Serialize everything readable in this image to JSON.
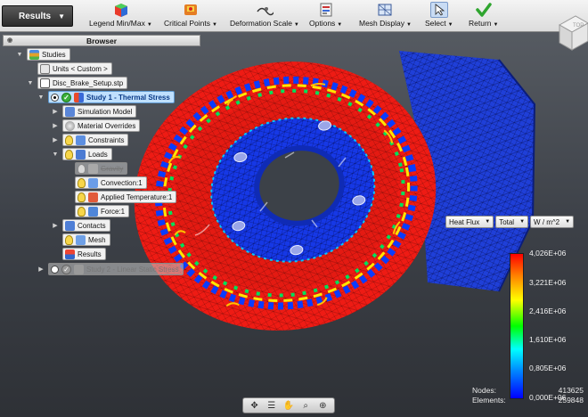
{
  "toolbar": {
    "results_label": "Results",
    "items": [
      {
        "label": "Legend Min/Max",
        "icon": "legend-minmax-icon"
      },
      {
        "label": "Critical Points",
        "icon": "critical-points-icon"
      },
      {
        "label": "Deformation Scale",
        "icon": "deformation-scale-icon"
      },
      {
        "label": "Options",
        "icon": "options-icon"
      },
      {
        "label": "Mesh Display",
        "icon": "mesh-display-icon"
      },
      {
        "label": "Select",
        "icon": "select-cursor-icon"
      },
      {
        "label": "Return",
        "icon": "return-checkmark-icon"
      }
    ]
  },
  "browser": {
    "title": "Browser",
    "tree": {
      "studies": "Studies",
      "units": "Units < Custom >",
      "file": "Disc_Brake_Setup.stp",
      "study1": "Study 1 - Thermal Stress",
      "simulation_model": "Simulation Model",
      "material_overrides": "Material Overrides",
      "constraints": "Constraints",
      "loads": "Loads",
      "gravity": "Gravity",
      "convection": "Convection:1",
      "applied_temperature": "Applied Temperature:1",
      "force": "Force:1",
      "contacts": "Contacts",
      "mesh": "Mesh",
      "results": "Results",
      "study2": "Study 2 - Linear Static Stress"
    }
  },
  "result_selector": {
    "quantity": "Heat Flux",
    "component": "Total",
    "unit": "W / m^2"
  },
  "legend": {
    "labels": [
      "4,026E+06",
      "3,221E+06",
      "2,416E+06",
      "1,610E+06",
      "0,805E+06",
      "0,000E+06"
    ],
    "colors": [
      "#ff0000",
      "#ff8000",
      "#ffff00",
      "#00ff00",
      "#00ffff",
      "#0080ff",
      "#0000ff"
    ]
  },
  "stats": {
    "nodes_label": "Nodes:",
    "nodes_value": "413625",
    "elements_label": "Elements:",
    "elements_value": "259848"
  },
  "viewcube": {
    "face_label": "TOP"
  }
}
